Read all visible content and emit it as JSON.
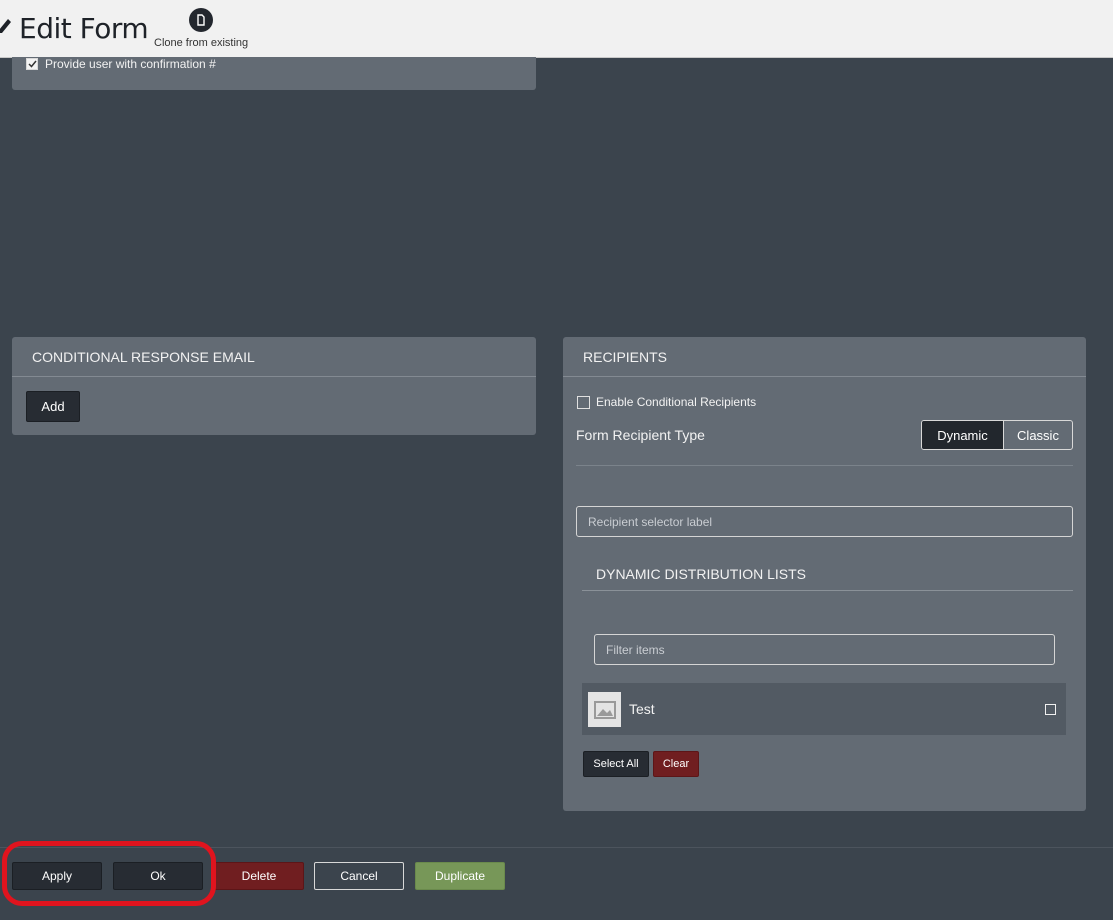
{
  "header": {
    "title": "Edit Form",
    "clone_label": "Clone from existing"
  },
  "top_section": {
    "confirmation_label": "Provide user with confirmation #",
    "confirmation_checked": true
  },
  "conditional_response": {
    "heading": "CONDITIONAL RESPONSE EMAIL",
    "add_label": "Add"
  },
  "recipients": {
    "heading": "RECIPIENTS",
    "enable_conditional_label": "Enable Conditional Recipients",
    "recipient_type_label": "Form Recipient Type",
    "type_options": [
      "Dynamic",
      "Classic"
    ],
    "selected_type": "Dynamic",
    "selector_placeholder": "Recipient selector label",
    "distribution_heading": "DYNAMIC DISTRIBUTION LISTS",
    "filter_placeholder": "Filter items",
    "items": [
      {
        "name": "Test",
        "checked": false
      }
    ],
    "select_all_label": "Select All",
    "clear_label": "Clear"
  },
  "footer": {
    "apply_label": "Apply",
    "ok_label": "Ok",
    "delete_label": "Delete",
    "cancel_label": "Cancel",
    "duplicate_label": "Duplicate"
  },
  "colors": {
    "highlight": "#e0141e"
  }
}
